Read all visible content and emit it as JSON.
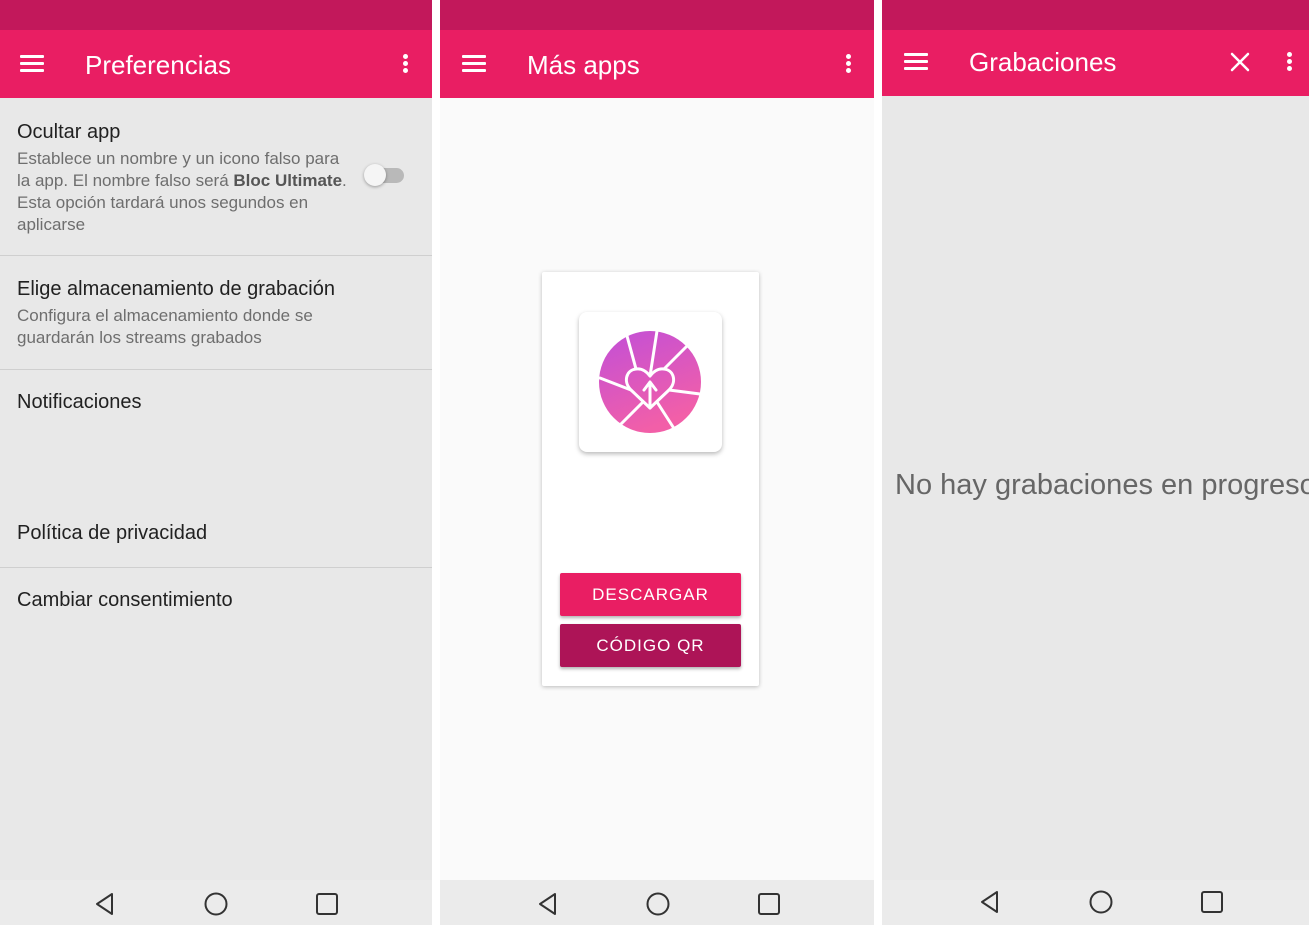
{
  "colors": {
    "status_bar": "#c2185b",
    "app_bar": "#e91e63",
    "accent_dark": "#ad1457",
    "background": "#e8e8e8"
  },
  "preferences_screen": {
    "title": "Preferencias",
    "items": [
      {
        "title": "Ocultar app",
        "description_parts": [
          "Establece un nombre y un icono falso para la app. El nombre falso será ",
          "Bloc Ultimate",
          ". Esta opción tardará unos segundos en aplicarse"
        ],
        "toggle": {
          "on": false
        }
      },
      {
        "title": "Elige almacenamiento de grabación",
        "description": "Configura el almacenamiento donde se guardarán los streams grabados"
      },
      {
        "title": "Notificaciones"
      },
      {
        "title": "Política de privacidad"
      },
      {
        "title": "Cambiar consentimiento"
      }
    ]
  },
  "more_apps_screen": {
    "title": "Más apps",
    "card": {
      "app_icon": "heart-camera-shutter-icon",
      "download_label": "DESCARGAR",
      "qr_label": "CÓDIGO QR"
    }
  },
  "recordings_screen": {
    "title": "Grabaciones",
    "empty_message": "No hay grabaciones en progreso"
  },
  "icons": {
    "menu": "hamburger-menu-icon",
    "more": "more-vertical-icon",
    "close": "close-icon",
    "nav": [
      "back-icon",
      "home-icon",
      "recents-icon"
    ]
  }
}
